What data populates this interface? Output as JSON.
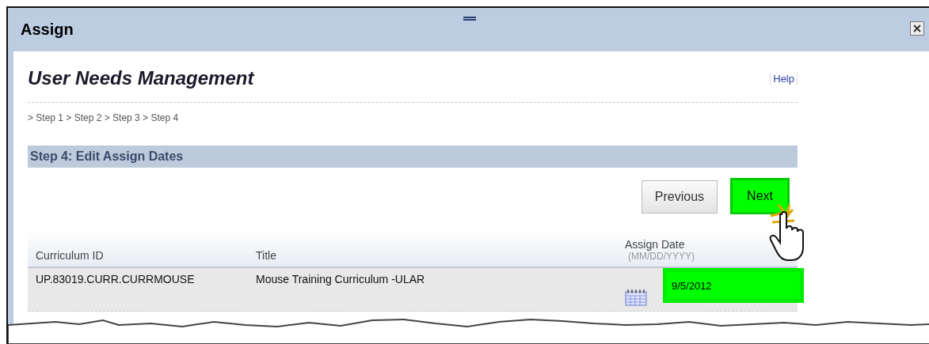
{
  "window": {
    "title": "Assign"
  },
  "page": {
    "heading": "User Needs Management",
    "help_link": "Help",
    "breadcrumb": "> Step 1 > Step 2 > Step 3 > Step 4"
  },
  "section": {
    "title": "Step 4: Edit Assign Dates"
  },
  "buttons": [
    {
      "label": "Previous",
      "highlighted": false
    },
    {
      "label": "Next",
      "highlighted": true
    }
  ],
  "table": {
    "columns": [
      {
        "label": "Curriculum ID"
      },
      {
        "label": "Title"
      },
      {
        "label": "Assign Date",
        "hint": "(MM/DD/YYYY)"
      }
    ],
    "rows": [
      {
        "curriculum_id": "UP.83019.CURR.CURRMOUSE",
        "title": "Mouse Training Curriculum -ULAR",
        "assign_date": "9/5/2012",
        "date_highlighted": true
      }
    ]
  }
}
